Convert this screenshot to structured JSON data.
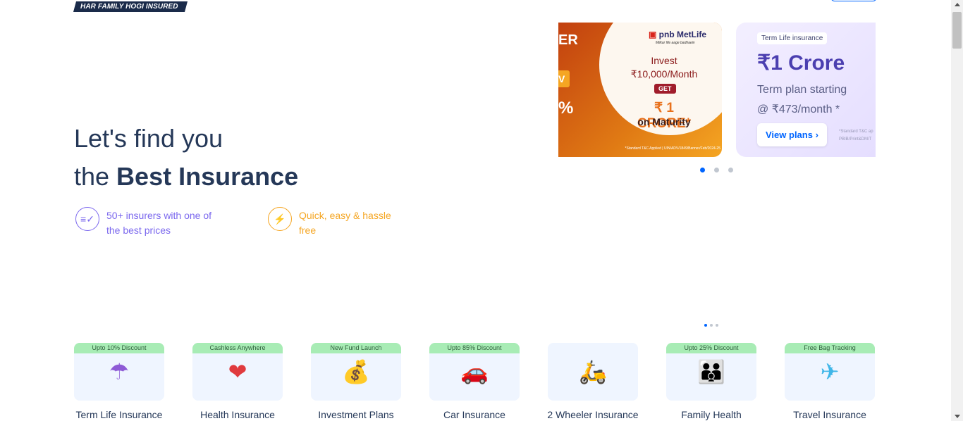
{
  "header": {
    "tagline": "HAR FAMILY HOGI INSURED"
  },
  "hero": {
    "line1": "Let's find you",
    "line2_prefix": "the ",
    "line2_bold": "Best Insurance"
  },
  "features": [
    {
      "text": "50+ insurers with one of the best prices",
      "icon": "compare-icon"
    },
    {
      "text": "Quick, easy & hassle free",
      "icon": "lightning-icon"
    }
  ],
  "banners": {
    "pnb": {
      "side_text_1": "ER",
      "side_text_2": "V",
      "side_text_3": "%",
      "logo": "pnb MetLife",
      "logo_sub": "Milkar life aage badhaein",
      "invest_line1": "Invest",
      "invest_line2": "₹10,000/Month",
      "get": "GET",
      "crore": "₹ 1 CRORE*",
      "maturity": "on Maturity",
      "fine_print": "*Standard T&C Applied | UIN/ADV/1849/Banner/Feb/2024-25"
    },
    "term": {
      "badge": "Term Life insurance",
      "headline": "₹1 Crore",
      "sub1": "Term plan starting",
      "sub2": "@ ₹473/month *",
      "button": "View plans ›",
      "fine_print": "*Standard T&C ap PBIB/Print&DM/T"
    },
    "active_index": 0,
    "count": 3
  },
  "products": [
    {
      "tag": "Upto 10% Discount",
      "name": "Term Life Insurance",
      "icon": "umbrella-icon",
      "glyph": "☂"
    },
    {
      "tag": "Cashless Anywhere",
      "name": "Health Insurance",
      "icon": "heart-pulse-icon",
      "glyph": "❤"
    },
    {
      "tag": "New Fund Launch",
      "name": "Investment Plans",
      "icon": "coins-growth-icon",
      "glyph": "💰"
    },
    {
      "tag": "Upto 85% Discount",
      "name": "Car Insurance",
      "icon": "car-icon",
      "glyph": "🚗"
    },
    {
      "tag": "",
      "name": "2 Wheeler Insurance",
      "icon": "scooter-icon",
      "glyph": "🛵"
    },
    {
      "tag": "Upto 25% Discount",
      "name": "Family Health",
      "icon": "family-icon",
      "glyph": "👪"
    },
    {
      "tag": "Free Bag Tracking",
      "name": "Travel Insurance",
      "icon": "airplane-icon",
      "glyph": "✈"
    }
  ],
  "products_carousel": {
    "active_index": 0,
    "count": 3
  }
}
